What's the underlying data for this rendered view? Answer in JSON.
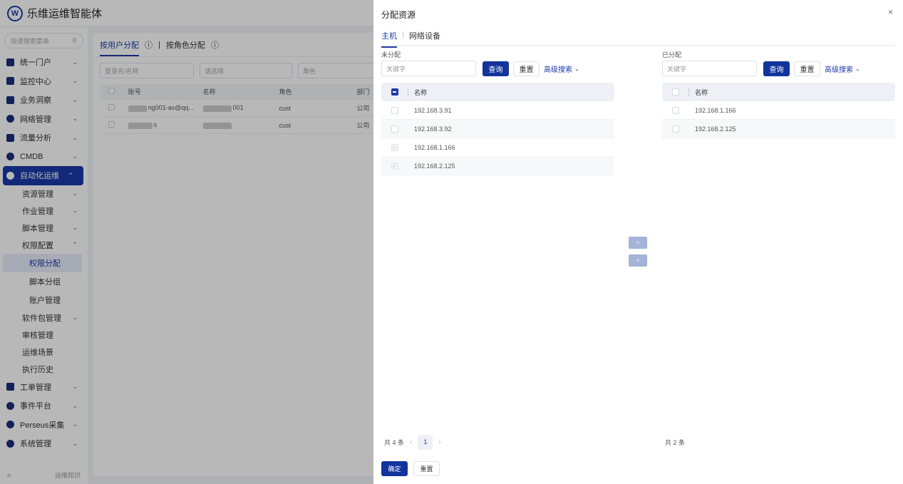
{
  "app": {
    "logo_letter": "W",
    "title": "乐维运维智能体"
  },
  "sidebar": {
    "search_placeholder": "快速搜索菜单",
    "menu": [
      {
        "label": "统一门户",
        "icon": "home-icon"
      },
      {
        "label": "监控中心",
        "icon": "monitor-icon"
      },
      {
        "label": "业务洞察",
        "icon": "insight-icon"
      },
      {
        "label": "网络管理",
        "icon": "network-icon"
      },
      {
        "label": "流量分析",
        "icon": "traffic-icon"
      },
      {
        "label": "CMDB",
        "icon": "cmdb-icon"
      },
      {
        "label": "自动化运维",
        "icon": "automation-icon"
      }
    ],
    "sub": [
      {
        "label": "资源管理"
      },
      {
        "label": "作业管理"
      },
      {
        "label": "脚本管理"
      },
      {
        "label": "权限配置"
      }
    ],
    "sub2": [
      {
        "label": "权限分配"
      },
      {
        "label": "脚本分组"
      },
      {
        "label": "账户管理"
      }
    ],
    "sub_after": [
      {
        "label": "软件包管理"
      },
      {
        "label": "审核管理"
      },
      {
        "label": "运维场景"
      },
      {
        "label": "执行历史"
      }
    ],
    "menu_after": [
      {
        "label": "工单管理"
      },
      {
        "label": "事件平台"
      },
      {
        "label": "Perseus采集"
      },
      {
        "label": "系统管理"
      }
    ],
    "bottom_text": "运维知识"
  },
  "background": {
    "tabs": [
      "按用户分配",
      "按角色分配"
    ],
    "filters": [
      "登录名/名称",
      "请选择",
      "角色"
    ],
    "table_headers": [
      "账号",
      "名称",
      "角色",
      "部门"
    ],
    "rows": [
      {
        "account": "ng001-as@qq...",
        "name": "001",
        "role": "cust",
        "dept": "公司"
      },
      {
        "account": "s",
        "name": "",
        "role": "cust",
        "dept": "公司"
      }
    ]
  },
  "drawer": {
    "title": "分配资源",
    "close_glyph": "×",
    "tabs": [
      "主机",
      "网络设备"
    ],
    "left": {
      "label": "未分配",
      "keyword_placeholder": "关键字",
      "query": "查询",
      "reset": "重置",
      "advanced": "高级搜索",
      "col_name": "名称",
      "rows": [
        "192.168.3.91",
        "192.168.3.92",
        "192.168.1.166",
        "192.168.2.125"
      ],
      "total": "共 4 条",
      "page": "1"
    },
    "right": {
      "label": "已分配",
      "keyword_placeholder": "关键字",
      "query": "查询",
      "reset": "重置",
      "advanced": "高级搜索",
      "col_name": "名称",
      "rows": [
        "192.168.1.166",
        "192.168.2.125"
      ],
      "total": "共 2 条"
    },
    "move_right": ">",
    "move_left": "<",
    "confirm": "确定",
    "reset": "重置"
  },
  "colors": {
    "primary": "#12349c",
    "accent": "#1a3aa8",
    "transfer_disabled": "#a4b3d8"
  }
}
